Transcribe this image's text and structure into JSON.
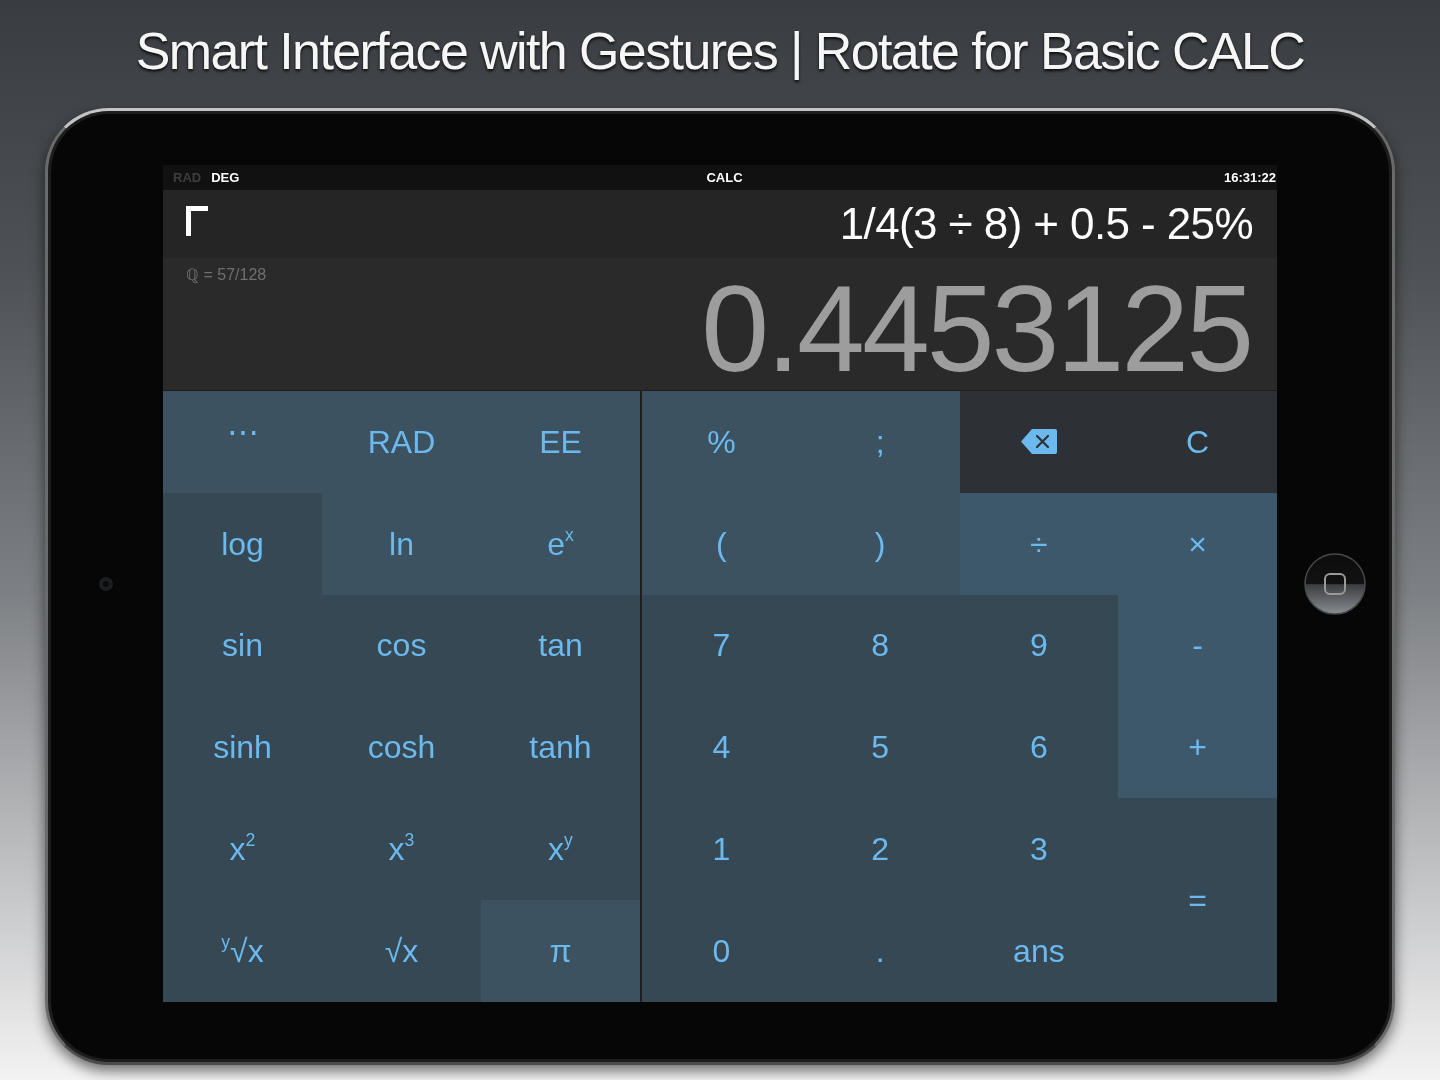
{
  "caption": "Smart Interface with Gestures | Rotate for Basic CALC",
  "status_bar": {
    "modes": [
      {
        "label": "RAD",
        "selected": false
      },
      {
        "label": "DEG",
        "selected": true
      }
    ],
    "title": "CALC",
    "time": "16:31:22"
  },
  "display": {
    "expression": "1/4(3 ÷ 8) + 0.5 - 25%",
    "fraction": "ℚ = 57/128",
    "result": "0.4453125"
  },
  "keypad": {
    "scientific": [
      {
        "label": "⋯",
        "kind": "light"
      },
      {
        "label": "RAD",
        "kind": "light"
      },
      {
        "label": "EE",
        "kind": "light"
      },
      {
        "label": "log",
        "kind": "dark"
      },
      {
        "label": "ln",
        "kind": "light"
      },
      {
        "label": "e$^{x}$",
        "kind": "light"
      },
      {
        "label": "sin",
        "kind": "dark"
      },
      {
        "label": "cos",
        "kind": "dark"
      },
      {
        "label": "tan",
        "kind": "dark"
      },
      {
        "label": "sinh",
        "kind": "dark"
      },
      {
        "label": "cosh",
        "kind": "dark"
      },
      {
        "label": "tanh",
        "kind": "dark"
      },
      {
        "label": "x$^{2}$",
        "kind": "dark"
      },
      {
        "label": "x$^{3}$",
        "kind": "dark"
      },
      {
        "label": "x$^{y}$",
        "kind": "dark"
      },
      {
        "label": "$^{y}$√x",
        "kind": "dark"
      },
      {
        "label": "√x",
        "kind": "dark"
      },
      {
        "label": "π",
        "kind": "light"
      }
    ],
    "standard": [
      {
        "label": "%",
        "kind": "light"
      },
      {
        "label": ";",
        "kind": "light"
      },
      {
        "kind": "backspace"
      },
      {
        "label": "C",
        "kind": "edit"
      },
      {
        "label": "(",
        "kind": "light"
      },
      {
        "label": ")",
        "kind": "light"
      },
      {
        "label": "÷",
        "kind": "operator"
      },
      {
        "label": "×",
        "kind": "operator"
      },
      {
        "label": "7",
        "kind": "dark"
      },
      {
        "label": "8",
        "kind": "dark"
      },
      {
        "label": "9",
        "kind": "dark"
      },
      {
        "label": "-",
        "kind": "operator"
      },
      {
        "label": "4",
        "kind": "dark"
      },
      {
        "label": "5",
        "kind": "dark"
      },
      {
        "label": "6",
        "kind": "dark"
      },
      {
        "label": "+",
        "kind": "operator"
      },
      {
        "label": "1",
        "kind": "dark"
      },
      {
        "label": "2",
        "kind": "dark"
      },
      {
        "label": "3",
        "kind": "dark"
      },
      {
        "label": "=",
        "kind": "equals"
      },
      {
        "label": "0",
        "kind": "dark"
      },
      {
        "label": ".",
        "kind": "dark"
      },
      {
        "label": "ans",
        "kind": "dark"
      }
    ]
  }
}
